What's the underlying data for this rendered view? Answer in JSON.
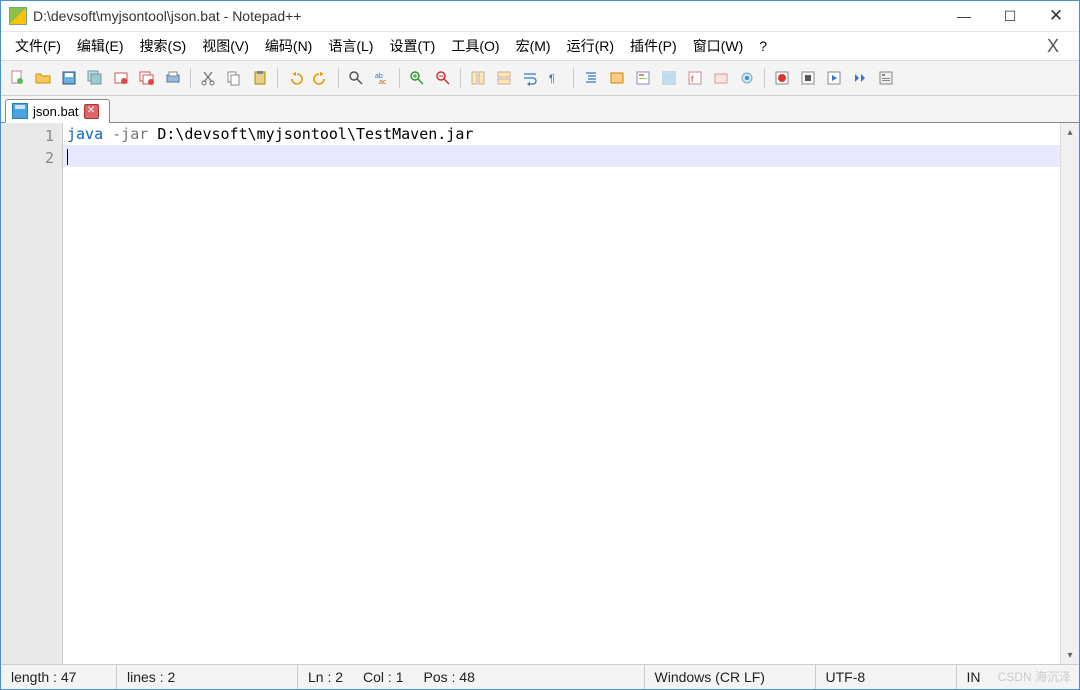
{
  "title": "D:\\devsoft\\myjsontool\\json.bat - Notepad++",
  "menu": {
    "file": "文件(F)",
    "edit": "编辑(E)",
    "search": "搜索(S)",
    "view": "视图(V)",
    "encoding": "编码(N)",
    "language": "语言(L)",
    "settings": "设置(T)",
    "tools": "工具(O)",
    "macro": "宏(M)",
    "run": "运行(R)",
    "plugins": "插件(P)",
    "window": "窗口(W)",
    "help": "?",
    "close": "X"
  },
  "tab": {
    "name": "json.bat"
  },
  "lines": {
    "1": "1",
    "2": "2"
  },
  "code": {
    "java": "java",
    "flag": " -jar ",
    "path": "D:\\devsoft\\myjsontool\\TestMaven.jar"
  },
  "status": {
    "length": "length : 47",
    "lines": "lines : 2",
    "ln": "Ln : 2",
    "col": "Col : 1",
    "pos": "Pos : 48",
    "eol": "Windows (CR LF)",
    "enc": "UTF-8",
    "ins": "IN"
  },
  "watermark": "CSDN 海沉泽"
}
